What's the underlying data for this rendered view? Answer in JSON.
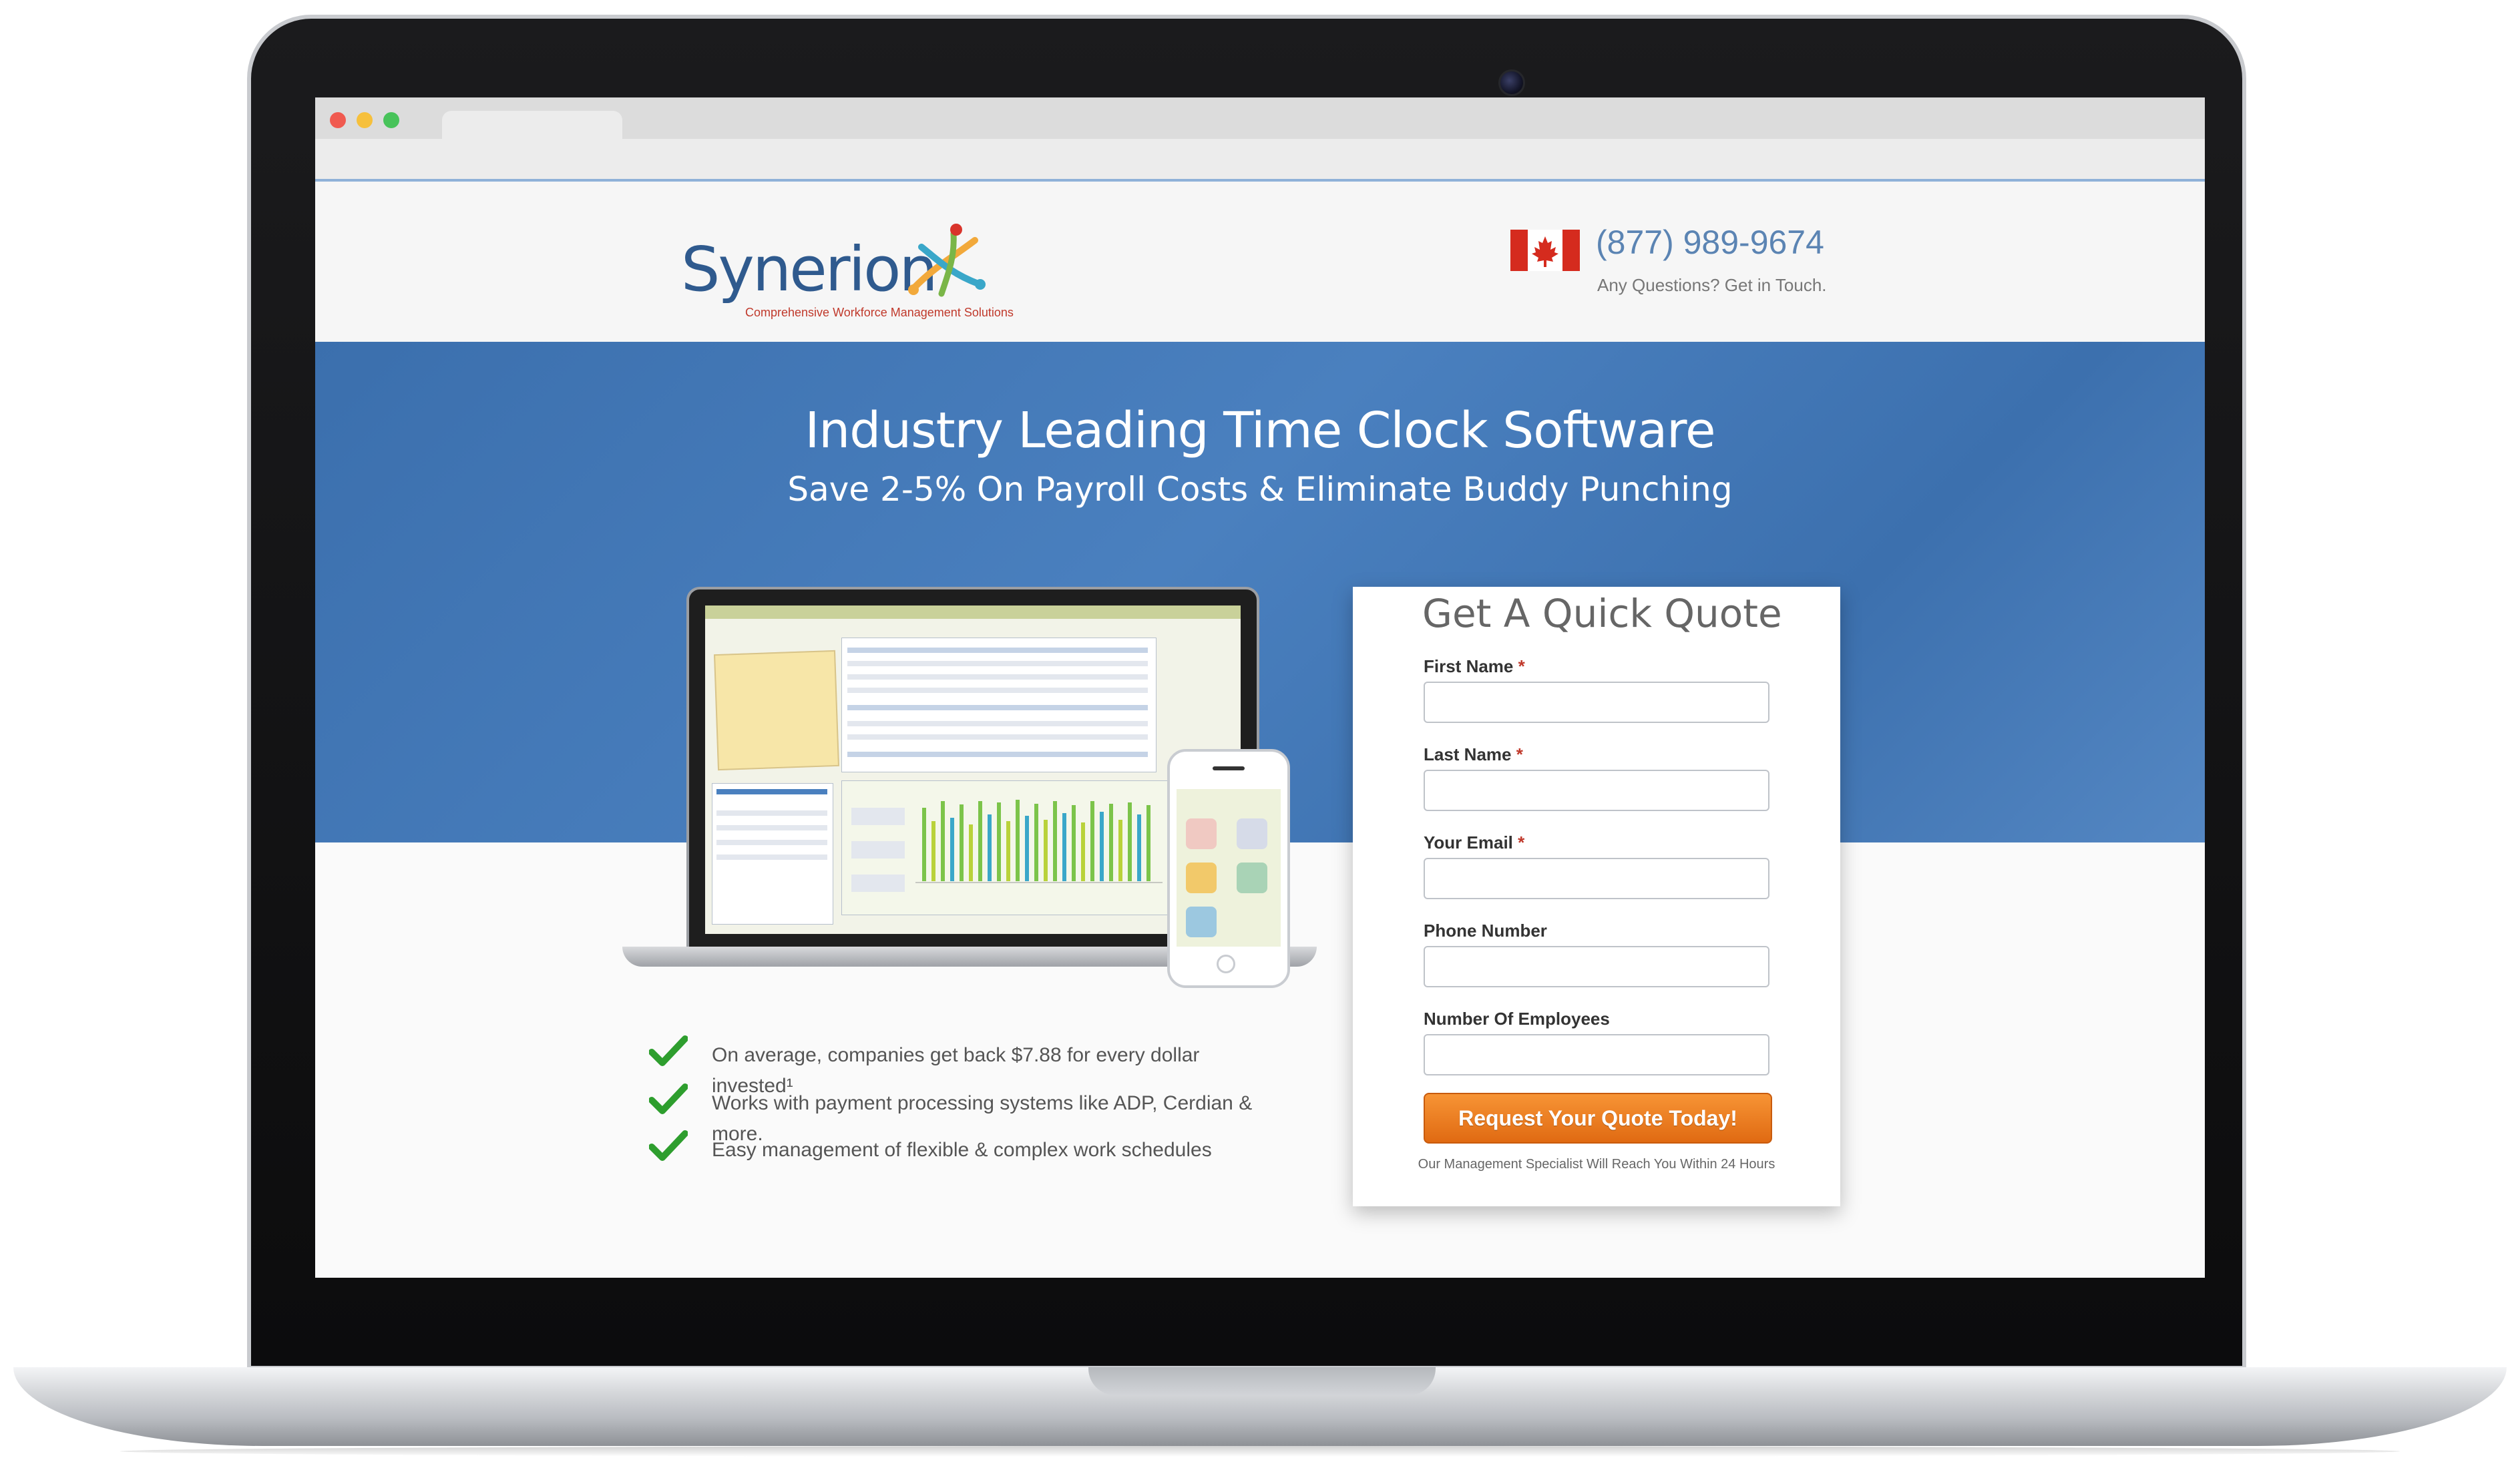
{
  "header": {
    "logo_text": "Synerion",
    "logo_tagline": "Comprehensive Workforce Management Solutions",
    "phone": "(877) 989-9674",
    "phone_sub": "Any Questions? Get in Touch."
  },
  "hero": {
    "title": "Industry Leading Time Clock Software",
    "subtitle": "Save 2-5% On Payroll Costs & Eliminate Buddy Punching"
  },
  "benefits": [
    "On average, companies get back $7.88 for every dollar invested¹",
    "Works with payment processing systems like ADP, Cerdian & more.",
    "Easy management of flexible & complex work schedules"
  ],
  "form": {
    "title": "Get A Quick Quote",
    "fields": [
      {
        "label": "First Name",
        "required": "*",
        "value": ""
      },
      {
        "label": "Last Name",
        "required": "*",
        "value": ""
      },
      {
        "label": "Your Email",
        "required": "*",
        "value": ""
      },
      {
        "label": "Phone Number",
        "required": "",
        "value": ""
      },
      {
        "label": "Number Of Employees",
        "required": "",
        "value": ""
      }
    ],
    "submit_label": "Request Your Quote Today!",
    "note": "Our Management Specialist Will Reach You Within 24 Hours"
  },
  "colors": {
    "hero_blue": "#3b6fad",
    "accent_orange": "#e06a12",
    "check_green": "#2e9e2e",
    "phone_blue": "#5b84b3"
  },
  "icons": {
    "browser_controls": [
      "close-dot",
      "minimize-dot",
      "zoom-dot"
    ],
    "flag": "canada-flag-icon",
    "benefit_bullet": "checkmark-icon"
  }
}
